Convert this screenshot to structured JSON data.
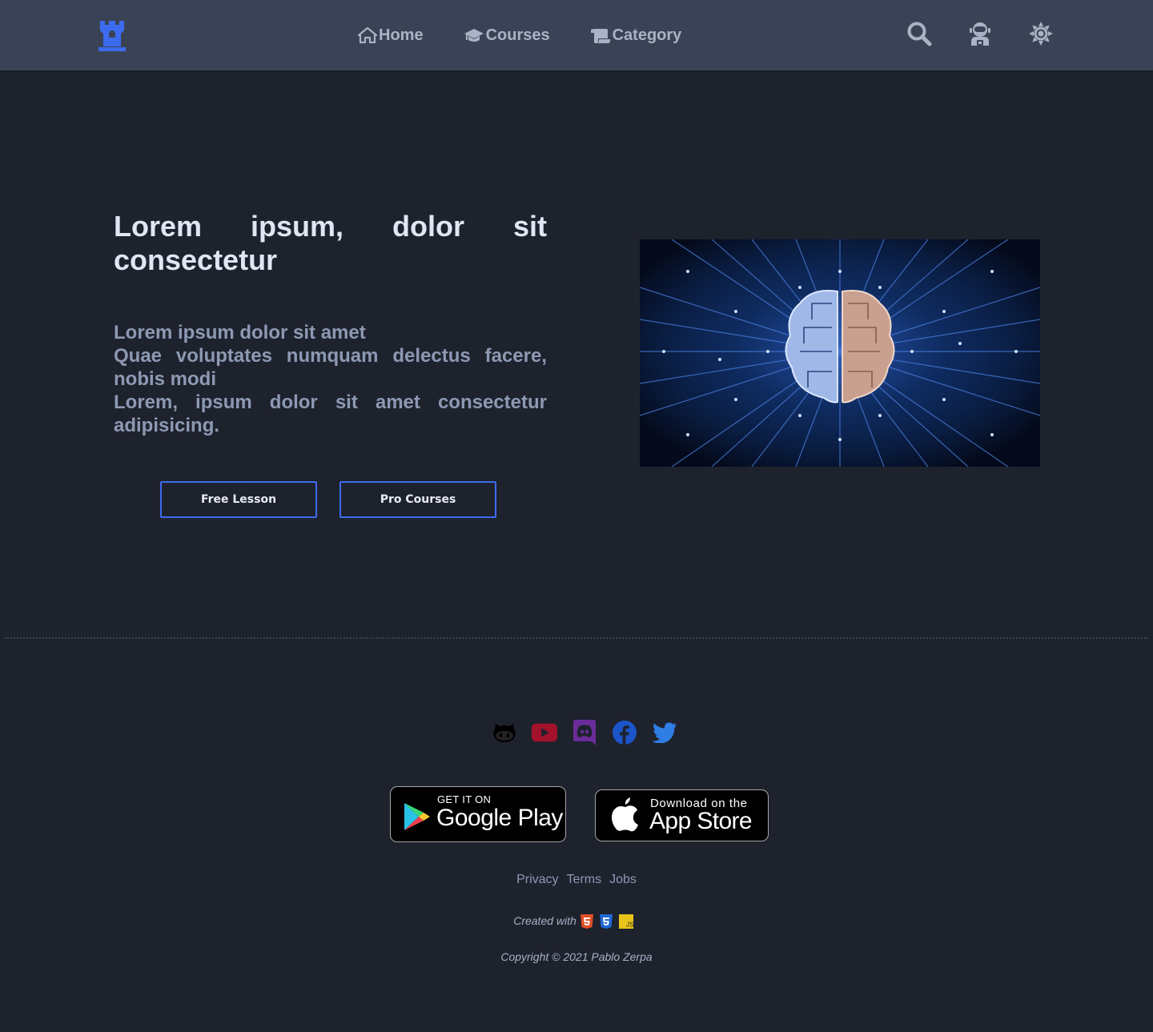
{
  "colors": {
    "accent": "#3d6bf0",
    "background": "#1e222d",
    "navbar": "#3a4356",
    "nav_text": "#aab3c5",
    "muted_text": "#8d99b3"
  },
  "nav": {
    "logo_icon": "castle-icon",
    "links": [
      {
        "label": "Home",
        "icon": "home-icon"
      },
      {
        "label": "Courses",
        "icon": "graduation-cap-icon"
      },
      {
        "label": "Category",
        "icon": "scroll-icon"
      }
    ],
    "actions": [
      "search-icon",
      "user-astronaut-icon",
      "sun-icon"
    ]
  },
  "hero": {
    "title_words": [
      "Lorem",
      "ipsum,",
      "dolor",
      "sit"
    ],
    "title_line2": "consectetur",
    "lines": [
      "Lorem ipsum dolor sit amet",
      "Quae voluptates numquam delectus facere, nobis modi",
      "Lorem, ipsum dolor sit amet consectetur adipisicing."
    ],
    "buttons": {
      "free": "Free Lesson",
      "pro": "Pro Courses"
    },
    "image": "circuit-brain-image"
  },
  "footer": {
    "socials": [
      "github-icon",
      "youtube-icon",
      "discord-icon",
      "facebook-icon",
      "twitter-icon"
    ],
    "google_play": {
      "small": "GET IT ON",
      "big": "Google Play"
    },
    "app_store": {
      "small": "Download on the",
      "big": "App Store"
    },
    "links": [
      "Privacy",
      "Terms",
      "Jobs"
    ],
    "created_with": "Created with",
    "tech": [
      "html5-icon",
      "css3-icon",
      "js-icon"
    ],
    "js_label": "JS",
    "copyright": "Copyright © 2021 Pablo Zerpa"
  }
}
